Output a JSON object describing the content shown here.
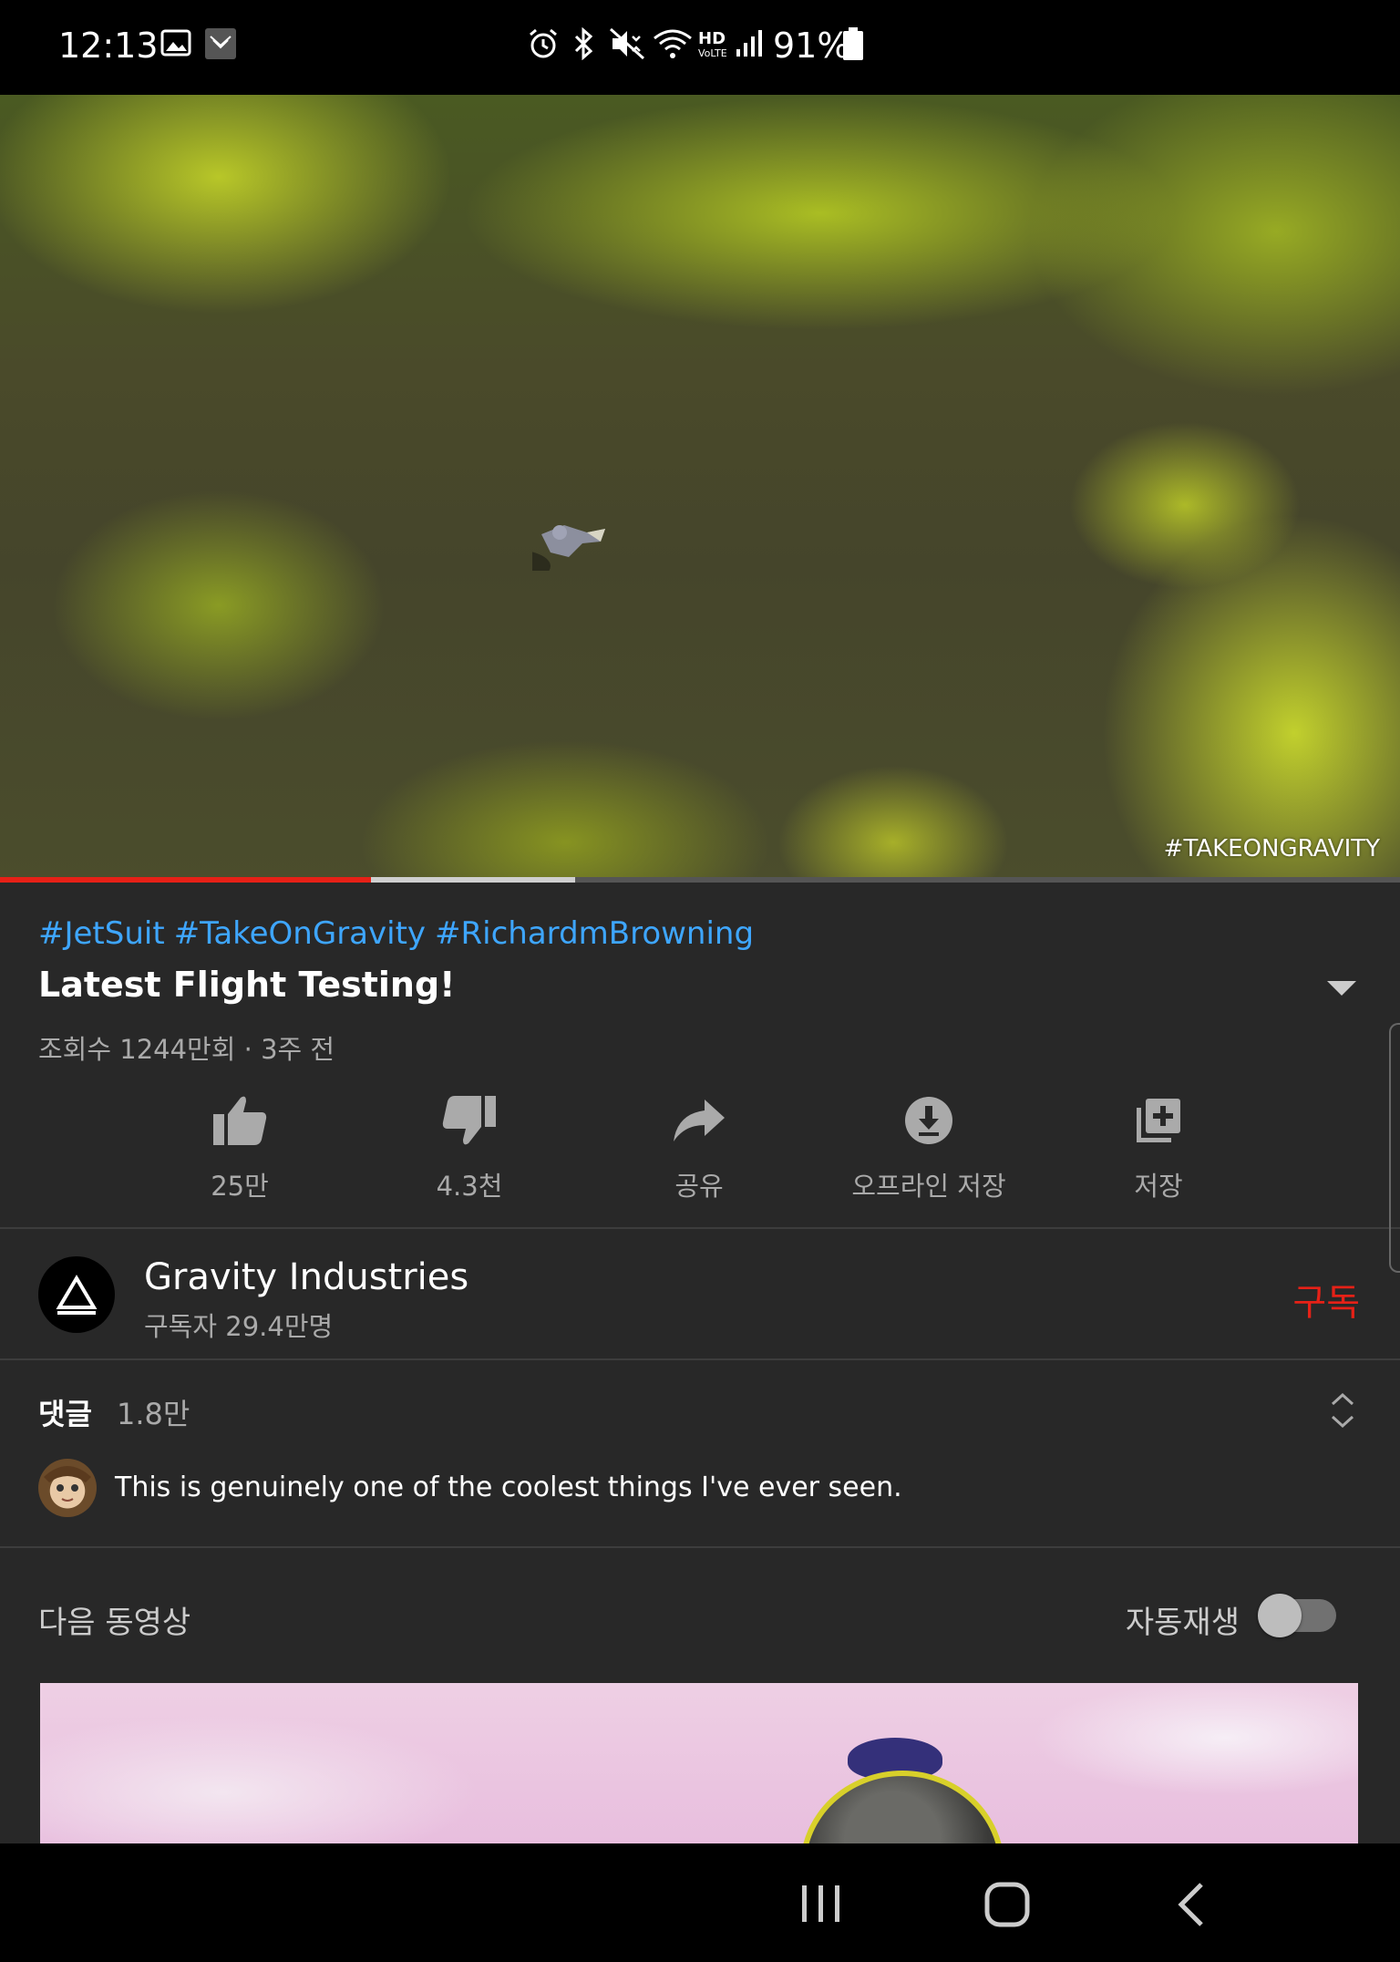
{
  "status_bar": {
    "time": "12:13",
    "battery": "91%",
    "icons": [
      "gallery-icon",
      "notification-app-icon",
      "alarm-icon",
      "bluetooth-icon",
      "mute-icon",
      "wifi-icon",
      "hd-voice-icon",
      "signal-icon",
      "battery-icon"
    ]
  },
  "video": {
    "watermark": "#TAKEONGRAVITY",
    "progress_played": 0.265,
    "progress_buffered": 0.411
  },
  "info": {
    "hashtags": [
      "#JetSuit",
      "#TakeOnGravity",
      "#RichardmBrowning"
    ],
    "title": "Latest Flight Testing!",
    "meta": "조회수 1244만회 · 3주 전"
  },
  "actions": [
    {
      "icon": "thumbs-up-icon",
      "label": "25만"
    },
    {
      "icon": "thumbs-down-icon",
      "label": "4.3천"
    },
    {
      "icon": "share-icon",
      "label": "공유"
    },
    {
      "icon": "download-icon",
      "label": "오프라인 저장"
    },
    {
      "icon": "add-to-playlist-icon",
      "label": "저장"
    }
  ],
  "channel": {
    "name": "Gravity Industries",
    "subscribers": "구독자 29.4만명",
    "subscribe_label": "구독"
  },
  "comments": {
    "title": "댓글",
    "count": "1.8만",
    "top_comment": "This is genuinely one of the coolest things I've ever seen."
  },
  "up_next": {
    "label": "다음 동영상",
    "autoplay_label": "자동재생",
    "autoplay_on": false
  },
  "colors": {
    "accent_red": "#e62117",
    "link_blue": "#3ea6ff",
    "background": "#282828"
  }
}
